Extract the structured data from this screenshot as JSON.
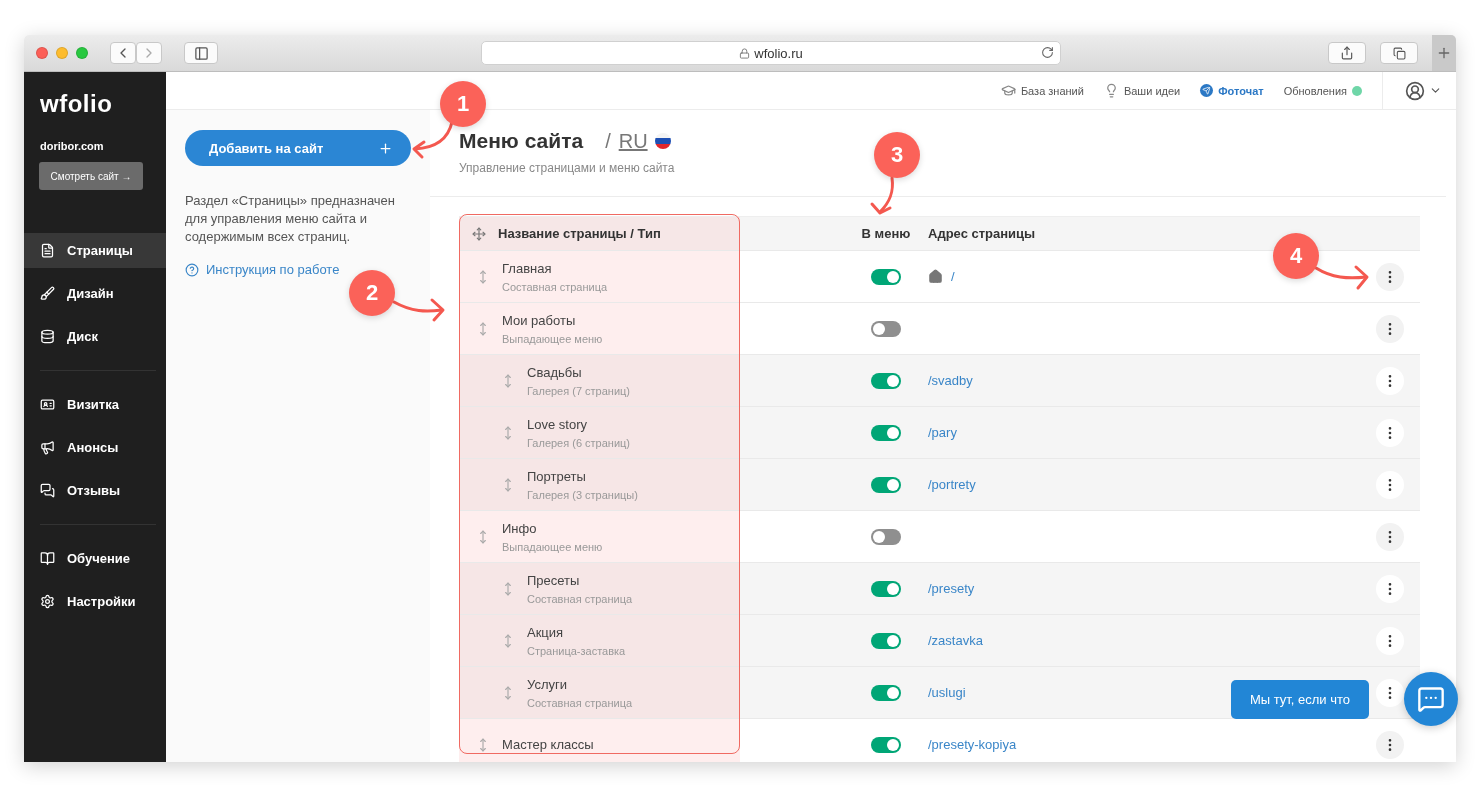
{
  "browser": {
    "url": "wfolio.ru"
  },
  "sidebar": {
    "logo": "wfolio",
    "site": "doribor.com",
    "view_button": "Смотреть сайт →",
    "groups": [
      {
        "items": [
          {
            "label": "Страницы",
            "selected": true
          },
          {
            "label": "Дизайн",
            "selected": false
          },
          {
            "label": "Диск",
            "selected": false
          }
        ]
      },
      {
        "items": [
          {
            "label": "Визитка",
            "selected": false
          },
          {
            "label": "Анонсы",
            "selected": false
          },
          {
            "label": "Отзывы",
            "selected": false
          }
        ]
      },
      {
        "items": [
          {
            "label": "Обучение",
            "selected": false
          },
          {
            "label": "Настройки",
            "selected": false
          }
        ]
      }
    ]
  },
  "topbar": {
    "links": [
      {
        "label": "База знаний",
        "kind": "plain"
      },
      {
        "label": "Ваши идеи",
        "kind": "plain"
      },
      {
        "label": "Фоточат",
        "kind": "accent"
      },
      {
        "label": "Обновления",
        "kind": "status"
      }
    ]
  },
  "left_panel": {
    "add_button": "Добавить на сайт",
    "description": "Раздел «Страницы» предназначен для управления меню сайта и содержимым всех страниц.",
    "help_link": "Инструкция по работе"
  },
  "header": {
    "title": "Меню сайта",
    "separator": "/",
    "language": "RU",
    "subtitle": "Управление страницами и меню сайта"
  },
  "table": {
    "columns": [
      "Название страницы / Тип",
      "В меню",
      "Адрес страницы"
    ],
    "rows": [
      {
        "title": "Главная",
        "type": "Составная страница",
        "in_menu": true,
        "home": true,
        "address": "/"
      },
      {
        "title": "Мои работы",
        "type": "Выпадающее меню",
        "in_menu": false,
        "home": false,
        "children": [
          {
            "title": "Свадьбы",
            "type": "Галерея (7 страниц)",
            "in_menu": true,
            "home": false,
            "address": "/svadby"
          },
          {
            "title": "Love story",
            "type": "Галерея (6 страниц)",
            "in_menu": true,
            "home": false,
            "address": "/pary"
          },
          {
            "title": "Портреты",
            "type": "Галерея (3 страницы)",
            "in_menu": true,
            "home": false,
            "address": "/portrety"
          }
        ]
      },
      {
        "title": "Инфо",
        "type": "Выпадающее меню",
        "in_menu": false,
        "home": false,
        "children": [
          {
            "title": "Пресеты",
            "type": "Составная страница",
            "in_menu": true,
            "home": false,
            "address": "/presety"
          },
          {
            "title": "Акция",
            "type": "Страница-заставка",
            "in_menu": true,
            "home": false,
            "address": "/zastavka"
          },
          {
            "title": "Услуги",
            "type": "Составная страница",
            "in_menu": true,
            "home": false,
            "address": "/uslugi"
          }
        ]
      },
      {
        "title": "Мастер классы",
        "in_menu": true,
        "home": false,
        "address": "/presety-kopiya"
      }
    ]
  },
  "chat": {
    "label": "Мы тут, если что"
  },
  "annotations": [
    {
      "number": "1"
    },
    {
      "number": "2"
    },
    {
      "number": "3"
    },
    {
      "number": "4"
    }
  ]
}
